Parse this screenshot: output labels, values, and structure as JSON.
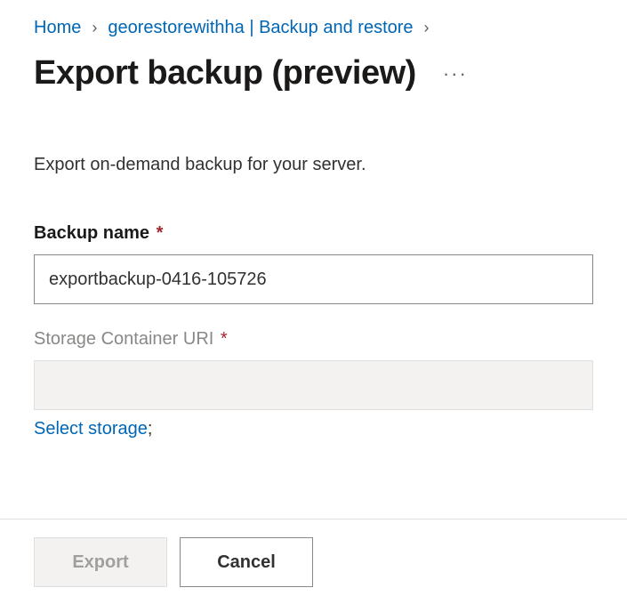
{
  "breadcrumb": {
    "home": "Home",
    "resource": "georestorewithha | Backup and restore"
  },
  "page": {
    "title": "Export backup (preview)",
    "description": "Export on-demand backup for your server."
  },
  "fields": {
    "backup_name": {
      "label": "Backup name",
      "value": "exportbackup-0416-105726"
    },
    "storage_uri": {
      "label": "Storage Container URI",
      "value": ""
    }
  },
  "links": {
    "select_storage": "Select storage"
  },
  "buttons": {
    "export": "Export",
    "cancel": "Cancel"
  },
  "symbols": {
    "required": "*",
    "breadcrumb_sep": "›",
    "ellipsis": "···",
    "semicolon": ";"
  }
}
